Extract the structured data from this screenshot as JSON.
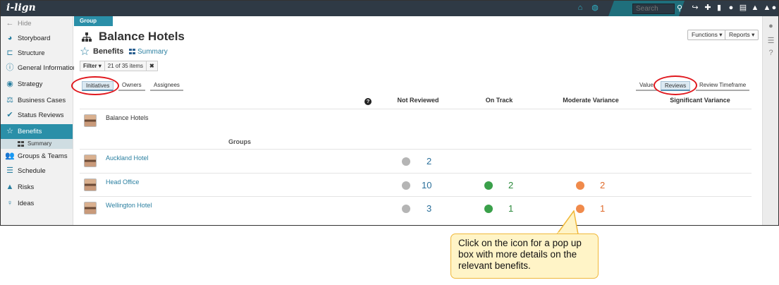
{
  "app": {
    "logo": "i-lign"
  },
  "topbar": {
    "search_placeholder": "Search",
    "icons": [
      "home-icon",
      "globe-icon",
      "search-icon",
      "share-icon",
      "plus-icon",
      "bookmark-icon",
      "chat-icon",
      "document-icon",
      "bell-icon",
      "alert-icon",
      "user-icon"
    ]
  },
  "sidebar": {
    "hide_label": "Hide",
    "items": [
      {
        "label": "Storyboard",
        "icon": "palette-icon"
      },
      {
        "label": "Structure",
        "icon": "structure-icon"
      },
      {
        "label": "General Information",
        "icon": "info-icon"
      },
      {
        "label": "Strategy",
        "icon": "compass-icon"
      },
      {
        "label": "Business Cases",
        "icon": "scales-icon"
      },
      {
        "label": "Status Reviews",
        "icon": "check-icon"
      },
      {
        "label": "Benefits",
        "icon": "star-icon"
      },
      {
        "label": "Groups & Teams",
        "icon": "people-icon"
      },
      {
        "label": "Schedule",
        "icon": "schedule-icon"
      },
      {
        "label": "Risks",
        "icon": "warning-icon"
      },
      {
        "label": "Ideas",
        "icon": "lightbulb-icon"
      }
    ],
    "sub_item": "Summary"
  },
  "main": {
    "breadcrumb": "Group",
    "title": "Balance Hotels",
    "subtitle": "Benefits",
    "summary_link": "Summary",
    "functions_label": "Functions ▾",
    "reports_label": "Reports ▾",
    "filter": {
      "label": "Filter ▾",
      "count": "21 of 35 items",
      "clear": "✖"
    },
    "tabs_left": [
      "Initiatives",
      "Owners",
      "Assignees"
    ],
    "tabs_right": [
      "Value",
      "Reviews",
      "Review Timeframe"
    ],
    "columns": [
      "Not Reviewed",
      "On Track",
      "Moderate Variance",
      "Significant Variance"
    ],
    "help": "?",
    "top_row": "Balance Hotels",
    "groups_label": "Groups",
    "rows": [
      {
        "name": "Auckland Hotel",
        "not_reviewed": "2",
        "on_track": "",
        "moderate": ""
      },
      {
        "name": "Head Office",
        "not_reviewed": "10",
        "on_track": "2",
        "moderate": "2"
      },
      {
        "name": "Wellington Hotel",
        "not_reviewed": "3",
        "on_track": "1",
        "moderate": "1"
      }
    ]
  },
  "colors": {
    "accent": "#2a8fa8",
    "not_reviewed": "#b5b5b5",
    "on_track": "#3aa04a",
    "moderate": "#f08a4b",
    "highlight": "#e0181e"
  },
  "callout": {
    "text": "Click on the icon for a pop up box with more details on the relevant benefits."
  }
}
